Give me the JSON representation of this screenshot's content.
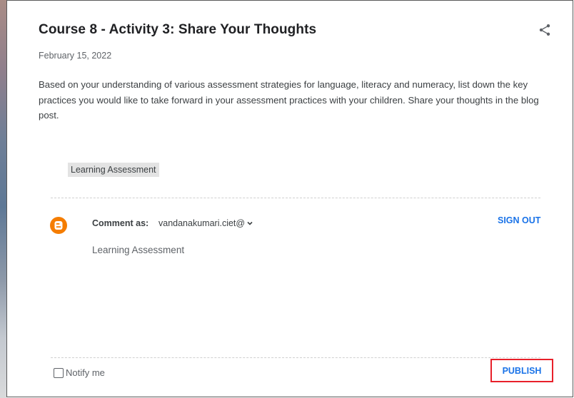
{
  "post": {
    "title": "Course 8 - Activity 3: Share Your Thoughts",
    "date": "February 15, 2022",
    "body": "Based on your understanding of various assessment strategies for language, literacy and numeracy, list down the key practices you would like to take forward in your assessment practices with your children. Share your thoughts in the blog post.",
    "label": "Learning Assessment",
    "share_icon": "share-icon"
  },
  "comment": {
    "avatar_icon": "blogger-icon",
    "comment_as_label": "Comment as:",
    "account": "vandanakumari.ciet@",
    "sign_out": "SIGN OUT",
    "text": "Learning Assessment",
    "notify_label": "Notify me",
    "publish": "PUBLISH"
  },
  "colors": {
    "accent": "#1a73e8",
    "blogger": "#f57d00",
    "highlight": "#e8202a"
  }
}
